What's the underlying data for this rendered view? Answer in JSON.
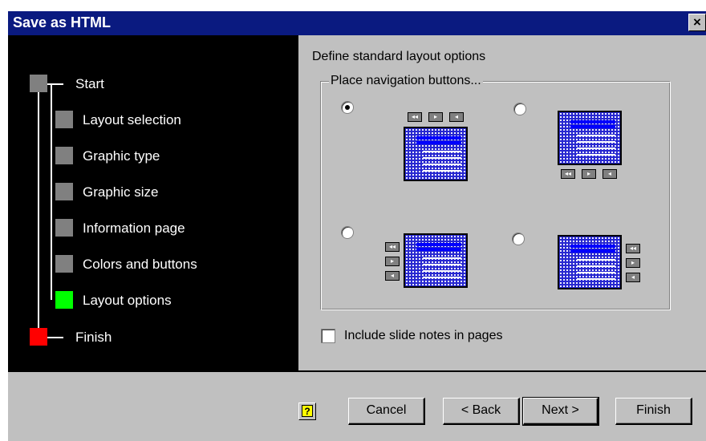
{
  "window": {
    "title": "Save as HTML",
    "close_glyph": "×"
  },
  "steps": [
    {
      "label": "Start",
      "color": "#808080"
    },
    {
      "label": "Layout selection",
      "color": "#808080"
    },
    {
      "label": "Graphic type",
      "color": "#808080"
    },
    {
      "label": "Graphic size",
      "color": "#808080"
    },
    {
      "label": "Information page",
      "color": "#808080"
    },
    {
      "label": "Colors and buttons",
      "color": "#808080"
    },
    {
      "label": "Layout options",
      "color": "#00ff00"
    },
    {
      "label": "Finish",
      "color": "#ff0000"
    }
  ],
  "content": {
    "heading": "Define standard layout options",
    "group_label": "Place navigation buttons...",
    "options": [
      {
        "name": "buttons-top",
        "selected": true
      },
      {
        "name": "buttons-bottom",
        "selected": false
      },
      {
        "name": "buttons-left",
        "selected": false
      },
      {
        "name": "buttons-right",
        "selected": false
      }
    ],
    "nav_glyphs": [
      "◂◂",
      "▸",
      "◂"
    ],
    "include_notes": {
      "label": "Include slide notes in pages",
      "checked": false
    }
  },
  "buttons": {
    "help": "?",
    "cancel": "Cancel",
    "back": "< Back",
    "next": "Next >",
    "finish": "Finish"
  },
  "colors": {
    "title_bar": "#0a1a80",
    "current_step": "#00ff00",
    "final_step": "#ff0000",
    "pending_step": "#808080"
  }
}
